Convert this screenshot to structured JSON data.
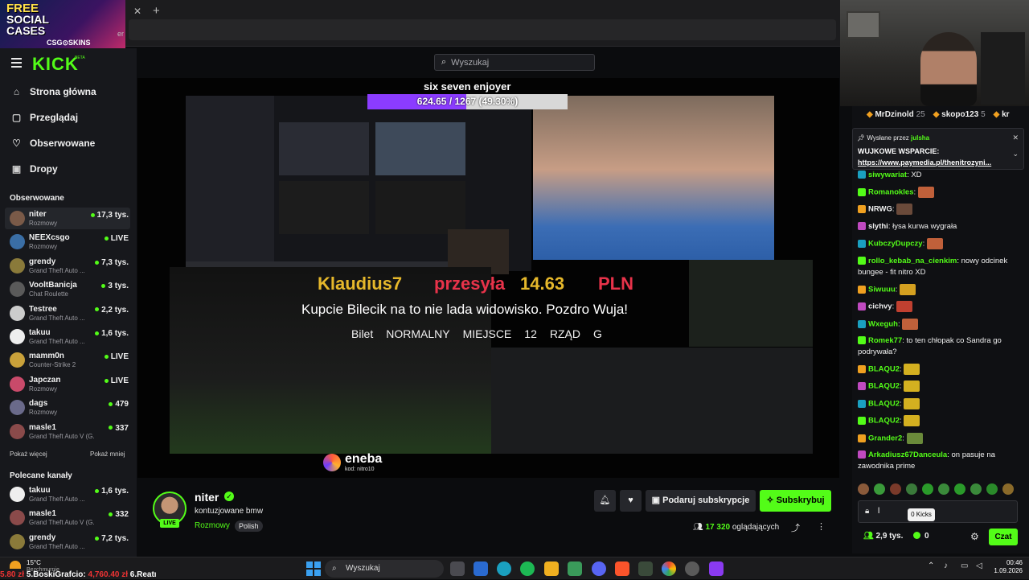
{
  "promo": {
    "line1": "FREE",
    "line2": "SOCIAL",
    "line3": "CASES",
    "sponsor": "CSG⊙SKINS"
  },
  "browser": {
    "tab_partial": "er"
  },
  "app": {
    "logo": "KICK",
    "logo_tag": "BETA"
  },
  "nav": [
    {
      "label": "Strona główna",
      "icon": "home-icon"
    },
    {
      "label": "Przeglądaj",
      "icon": "browse-icon"
    },
    {
      "label": "Obserwowane",
      "icon": "heart-icon"
    },
    {
      "label": "Dropy",
      "icon": "gift-icon"
    }
  ],
  "followed": {
    "title": "Obserwowane",
    "channels": [
      {
        "name": "niter",
        "category": "Rozmowy",
        "viewers": "17,3 tys.",
        "color": "#7a5a48"
      },
      {
        "name": "NEEXcsgo",
        "category": "Rozmowy",
        "viewers": "LIVE",
        "color": "#3a6ea5"
      },
      {
        "name": "grendy",
        "category": "Grand Theft Auto ...",
        "viewers": "7,3 tys.",
        "color": "#8a7a3a"
      },
      {
        "name": "VooltBanicja",
        "category": "Chat Roulette",
        "viewers": "3 tys.",
        "color": "#5a5a5a"
      },
      {
        "name": "Testree",
        "category": "Grand Theft Auto ...",
        "viewers": "2,2 tys.",
        "color": "#cccccc"
      },
      {
        "name": "takuu",
        "category": "Grand Theft Auto ...",
        "viewers": "1,6 tys.",
        "color": "#eeeeee"
      },
      {
        "name": "mamm0n",
        "category": "Counter-Strike 2",
        "viewers": "LIVE",
        "color": "#c9a13a"
      },
      {
        "name": "Japczan",
        "category": "Rozmowy",
        "viewers": "LIVE",
        "color": "#c94a6a"
      },
      {
        "name": "dags",
        "category": "Rozmowy",
        "viewers": "479",
        "color": "#6a6a8a"
      },
      {
        "name": "masle1",
        "category": "Grand Theft Auto V (G...",
        "viewers": "337",
        "color": "#8a4a4a"
      }
    ],
    "show_more": "Pokaż więcej",
    "show_less": "Pokaż mniej"
  },
  "recommended": {
    "title": "Polecane kanały",
    "channels": [
      {
        "name": "takuu",
        "category": "Grand Theft Auto ...",
        "viewers": "1,6 tys.",
        "color": "#eeeeee"
      },
      {
        "name": "masle1",
        "category": "Grand Theft Auto V (G...",
        "viewers": "332",
        "color": "#8a4a4a"
      },
      {
        "name": "grendy",
        "category": "Grand Theft Auto ...",
        "viewers": "7,2 tys.",
        "color": "#8a7a3a"
      }
    ]
  },
  "search": {
    "placeholder": "Wyszukaj"
  },
  "video": {
    "goal_title": "six seven enjoyer",
    "goal_text": "624.65 / 1267 (49.30%)",
    "goal_progress": 0.493,
    "donor": "Klaudius7",
    "verb": "przesyła",
    "amount": "14.63",
    "currency": "PLN",
    "message": "Kupcie Bilecik na to nie lada widowisko. Pozdro Wuja!",
    "ticket": [
      "Bilet",
      "NORMALNY",
      "MIEJSCE",
      "12",
      "RZĄD",
      "G"
    ],
    "sponsor": "eneba",
    "sponsor_code": "kod: nitro10"
  },
  "stream": {
    "streamer": "niter",
    "live": "LIVE",
    "title": "kontuzjowane bmw",
    "category": "Rozmowy",
    "language": "Polish",
    "viewers_count": "17 320",
    "viewers_label": "oglądających",
    "gift_label": "Podaruj subskrypcje",
    "sub_label": "Subskrybuj"
  },
  "chat": {
    "leaderboard": [
      {
        "name": "MrDzinold",
        "points": "25"
      },
      {
        "name": "skopo123",
        "points": "5"
      },
      {
        "name": "kr",
        "points": ""
      }
    ],
    "pinned": {
      "sent_by": "Wysłane przez",
      "author": "julsha",
      "line1": "WUJKOWE WSPARCIE:",
      "line2": "https://www.paymedia.pl/thenitrozyni..."
    },
    "messages": [
      {
        "user": "siwywariat",
        "color": "#53fc18",
        "text": "XD",
        "emote": ""
      },
      {
        "user": "Romanokles",
        "color": "#53fc18",
        "text": "",
        "emote": "#c0603a"
      },
      {
        "user": "NRWG",
        "color": "#f0f0f0",
        "text": "",
        "emote": "#6a4a3a"
      },
      {
        "user": "slythi",
        "color": "#f0f0f0",
        "text": "łysa kurwa wygrała",
        "emote": ""
      },
      {
        "user": "KubczyDupczy",
        "color": "#53fc18",
        "text": "",
        "emote": "#c0603a"
      },
      {
        "user": "rollo_kebab_na_cienkim",
        "color": "#53fc18",
        "text": "nowy odcinek bungee - fit nitro XD",
        "emote": ""
      },
      {
        "user": "Siwuuu",
        "color": "#53fc18",
        "text": "",
        "emote": "#d4a020"
      },
      {
        "user": "cichvy",
        "color": "#f0f0f0",
        "text": "",
        "emote": "#c04030"
      },
      {
        "user": "Wxeguh",
        "color": "#53fc18",
        "text": "",
        "emote": "#c0603a"
      },
      {
        "user": "Romek77",
        "color": "#53fc18",
        "text": "to ten chłopak co Sandra go podrywała?",
        "emote": ""
      },
      {
        "user": "BLAQU2",
        "color": "#53fc18",
        "text": "",
        "emote": "#d4b020"
      },
      {
        "user": "BLAQU2",
        "color": "#53fc18",
        "text": "",
        "emote": "#d4b020"
      },
      {
        "user": "BLAQU2",
        "color": "#53fc18",
        "text": "",
        "emote": "#d4b020"
      },
      {
        "user": "BLAQU2",
        "color": "#53fc18",
        "text": "",
        "emote": "#d4b020"
      },
      {
        "user": "Grander2",
        "color": "#53fc18",
        "text": "",
        "emote": "#6a8a3a"
      },
      {
        "user": "Arkadiusz67Danceula",
        "color": "#53fc18",
        "text": "on pasuje na zawodnika prime",
        "emote": ""
      }
    ],
    "input_value": "l",
    "kicks_tooltip": "0 Kicks",
    "footer_viewers": "2,9 tys.",
    "kicks_count": "0",
    "chat_button": "Czat"
  },
  "taskbar": {
    "temp": "15°C",
    "weather": "Bezchmurnie",
    "ticker_prefix": "5.80 zł",
    "ticker_name1": "5.BoskiGrafcio:",
    "ticker_amount": "4,760.40 zł",
    "ticker_name2": "6.Reatı",
    "search": "Wyszukaj",
    "time": "00:46",
    "date": "1.09.2026"
  },
  "colors": {
    "accent": "#53fc18",
    "background": "#0b0c0e"
  }
}
